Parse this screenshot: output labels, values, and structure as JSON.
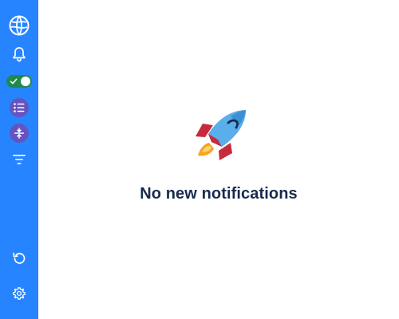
{
  "sidebar": {
    "top_items": [
      {
        "name": "globe-icon"
      },
      {
        "name": "bell-icon"
      },
      {
        "name": "toggle",
        "state": "on"
      },
      {
        "name": "list-icon"
      },
      {
        "name": "collapse-icon"
      },
      {
        "name": "filter-icon"
      }
    ],
    "bottom_items": [
      {
        "name": "undo-icon"
      },
      {
        "name": "gear-icon"
      }
    ]
  },
  "empty_state": {
    "illustration": "rocket",
    "title": "No new notifications"
  },
  "colors": {
    "sidebar": "#2684ff",
    "toggle_on": "#1f8a4c",
    "circle_button": "#6554c0",
    "title": "#172b4d"
  }
}
